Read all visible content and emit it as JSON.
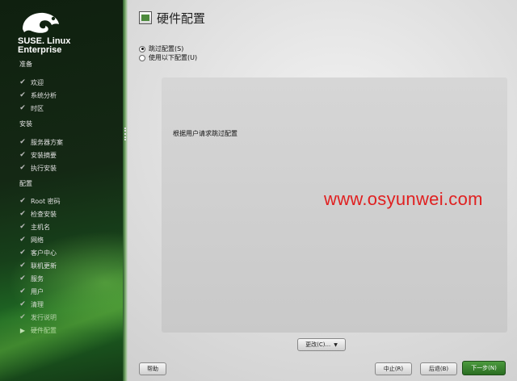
{
  "sidebar": {
    "brand_line1": "SUSE. Linux",
    "brand_line2": "Enterprise",
    "logo_icon": "suse-chameleon-icon",
    "sections": [
      {
        "label": "准备"
      },
      {
        "label": "安装"
      },
      {
        "label": "配置"
      }
    ],
    "steps": [
      {
        "label": "欢迎",
        "state": "done"
      },
      {
        "label": "系统分析",
        "state": "done"
      },
      {
        "label": "时区",
        "state": "done"
      },
      {
        "label": "服务器方案",
        "state": "done"
      },
      {
        "label": "安装摘要",
        "state": "done"
      },
      {
        "label": "执行安装",
        "state": "done"
      },
      {
        "label": "Root 密码",
        "state": "done"
      },
      {
        "label": "检查安装",
        "state": "done"
      },
      {
        "label": "主机名",
        "state": "done"
      },
      {
        "label": "网络",
        "state": "done"
      },
      {
        "label": "客户中心",
        "state": "done"
      },
      {
        "label": "联机更新",
        "state": "done"
      },
      {
        "label": "服务",
        "state": "done"
      },
      {
        "label": "用户",
        "state": "done"
      },
      {
        "label": "清理",
        "state": "done"
      },
      {
        "label": "发行说明",
        "state": "done"
      },
      {
        "label": "硬件配置",
        "state": "current"
      }
    ]
  },
  "main": {
    "title": "硬件配置",
    "title_icon": "hardware-icon",
    "options": [
      {
        "label": "跳过配置(S)",
        "selected": true
      },
      {
        "label": "使用以下配置(U)",
        "selected": false
      }
    ],
    "message": "根据用户请求跳过配置",
    "watermark": "www.osyunwei.com"
  },
  "buttons": {
    "change": "更改(C)...",
    "help": "帮助",
    "abort": "中止(R)",
    "back": "后退(B)",
    "next": "下一步(N)"
  },
  "colors": {
    "sidebar_dark": "#142814",
    "sidebar_green": "#1f6a24",
    "primary_button": "#2a6e22",
    "watermark": "#e02020"
  }
}
